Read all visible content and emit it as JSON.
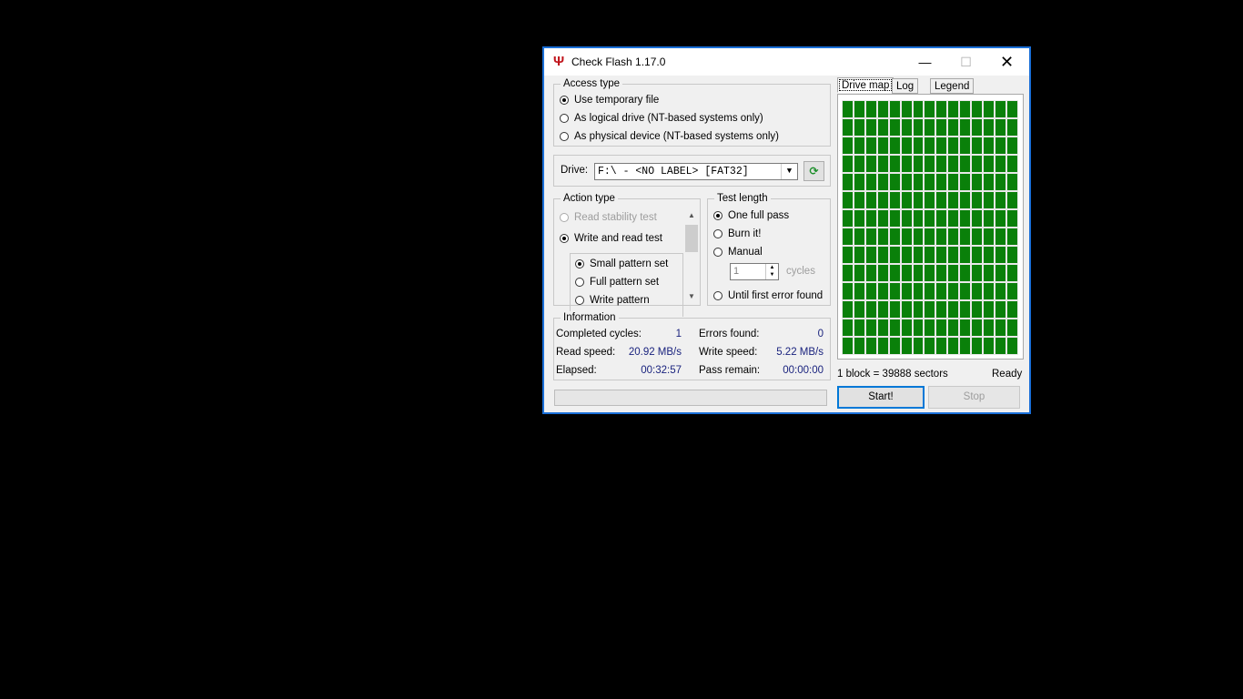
{
  "window": {
    "title": "Check Flash 1.17.0",
    "controls": {
      "minimize": "—",
      "maximize": "☐",
      "close": "✕"
    },
    "accent_color": "#1a6fd8"
  },
  "access_type": {
    "title": "Access type",
    "options": [
      {
        "label": "Use temporary file",
        "selected": true
      },
      {
        "label": "As logical drive (NT-based systems only)",
        "selected": false
      },
      {
        "label": "As physical device (NT-based systems only)",
        "selected": false
      }
    ]
  },
  "drive": {
    "label": "Drive:",
    "value": "F:\\ - <NO LABEL> [FAT32]",
    "refresh_icon": "refresh-icon"
  },
  "action_type": {
    "title": "Action type",
    "options": [
      {
        "label": "Read stability test",
        "selected": false,
        "disabled": true
      },
      {
        "label": "Write and read test",
        "selected": true
      }
    ],
    "sub_options": [
      {
        "label": "Small pattern set",
        "selected": true
      },
      {
        "label": "Full pattern set",
        "selected": false
      },
      {
        "label": "Write pattern",
        "selected": false
      }
    ]
  },
  "test_length": {
    "title": "Test length",
    "options": [
      {
        "label": "One full pass",
        "selected": true
      },
      {
        "label": "Burn it!",
        "selected": false
      },
      {
        "label": "Manual",
        "selected": false
      },
      {
        "label": "Until first error found",
        "selected": false
      }
    ],
    "cycles_value": "1",
    "cycles_label": "cycles"
  },
  "information": {
    "title": "Information",
    "completed_cycles_label": "Completed cycles:",
    "completed_cycles_value": "1",
    "errors_found_label": "Errors found:",
    "errors_found_value": "0",
    "read_speed_label": "Read speed:",
    "read_speed_value": "20.92 MB/s",
    "write_speed_label": "Write speed:",
    "write_speed_value": "5.22 MB/s",
    "elapsed_label": "Elapsed:",
    "elapsed_value": "00:32:57",
    "pass_remain_label": "Pass remain:",
    "pass_remain_value": "00:00:00"
  },
  "progress": 0,
  "tabs": [
    {
      "label": "Drive map",
      "active": true
    },
    {
      "label": "Log",
      "active": false
    },
    {
      "label": "Legend",
      "active": false
    }
  ],
  "drive_map": {
    "columns": 15,
    "rows": 14,
    "block_color": "#0a800a",
    "block_info": "1 block = 39888 sectors",
    "status": "Ready"
  },
  "buttons": {
    "start": "Start!",
    "stop": "Stop"
  }
}
